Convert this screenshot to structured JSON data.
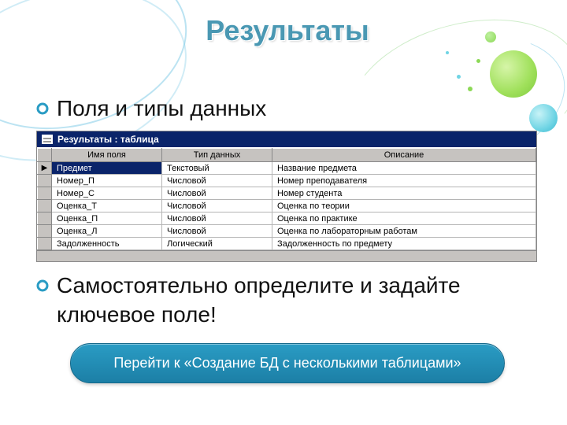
{
  "title": "Результаты",
  "bullets": {
    "fields": "Поля и типы данных",
    "task": "Самостоятельно определите и задайте ключевое поле!"
  },
  "window": {
    "title": "Результаты : таблица"
  },
  "headers": {
    "field": "Имя поля",
    "type": "Тип данных",
    "desc": "Описание"
  },
  "rows": [
    {
      "marker": "▶",
      "field": "Предмет",
      "type": "Текстовый",
      "desc": "Название предмета",
      "selected": true
    },
    {
      "marker": "",
      "field": "Номер_П",
      "type": "Числовой",
      "desc": "Номер преподавателя",
      "selected": false
    },
    {
      "marker": "",
      "field": "Номер_С",
      "type": "Числовой",
      "desc": "Номер студента",
      "selected": false
    },
    {
      "marker": "",
      "field": "Оценка_Т",
      "type": "Числовой",
      "desc": "Оценка по теории",
      "selected": false
    },
    {
      "marker": "",
      "field": "Оценка_П",
      "type": "Числовой",
      "desc": "Оценка по практике",
      "selected": false
    },
    {
      "marker": "",
      "field": "Оценка_Л",
      "type": "Числовой",
      "desc": "Оценка по лабораторным работам",
      "selected": false
    },
    {
      "marker": "",
      "field": "Задолженность",
      "type": "Логический",
      "desc": "Задолженность по предмету",
      "selected": false
    }
  ],
  "link": "Перейти к «Создание БД с несколькими таблицами»"
}
